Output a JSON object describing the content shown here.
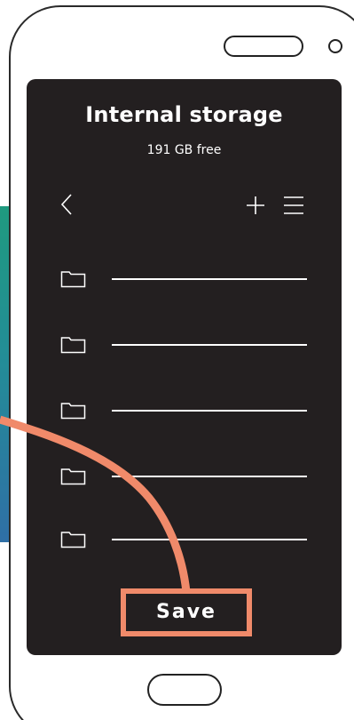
{
  "storage": {
    "title": "Internal storage",
    "free_space": "191 GB free"
  },
  "toolbar": {
    "back_icon": "chevron-left-icon",
    "add_icon": "plus-icon",
    "menu_icon": "hamburger-menu-icon"
  },
  "folders": [
    {
      "icon": "folder-icon",
      "name": ""
    },
    {
      "icon": "folder-icon",
      "name": ""
    },
    {
      "icon": "folder-icon",
      "name": ""
    },
    {
      "icon": "folder-icon",
      "name": ""
    },
    {
      "icon": "folder-icon",
      "name": ""
    }
  ],
  "actions": {
    "save_label": "Save"
  },
  "colors": {
    "screen_background": "#231f20",
    "accent": "#f08a6a",
    "side_band_top": "#1f9a7f",
    "side_band_bottom": "#2f6fa6",
    "text": "#ffffff"
  }
}
